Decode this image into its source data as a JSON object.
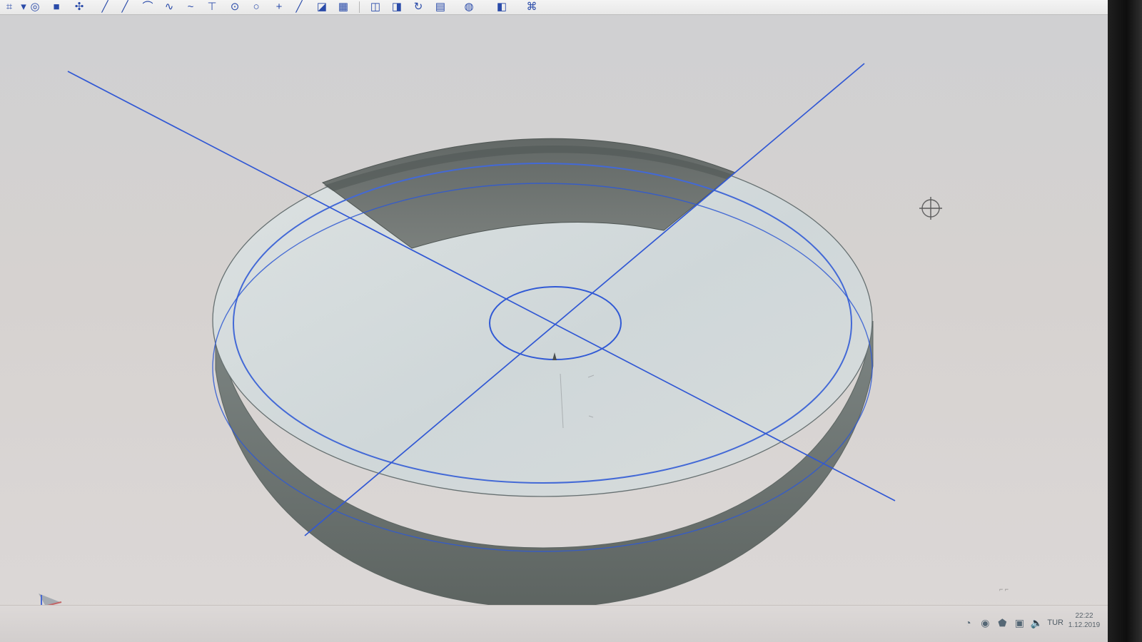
{
  "window": {
    "title": ""
  },
  "toolbar": {
    "icons": [
      "select-icon",
      "dropdown-icon",
      "sphere-icon",
      "box-icon",
      "dots-grid-icon",
      "line-icon",
      "line-icon",
      "curve-icon",
      "freeform-curve-icon",
      "wave-icon",
      "plane-icon",
      "circle-point-icon",
      "circle-icon",
      "plus-icon",
      "line-icon",
      "plane-icon",
      "grid-icon",
      "view-icon",
      "view-icon",
      "rotate-icon",
      "layers-icon",
      "palette-icon",
      "cube-icon",
      "lasso-icon"
    ]
  },
  "viewport": {
    "cursor": "crosshair",
    "axis_indicator": "axis-triad-icon"
  },
  "taskbar": {
    "lang": "TUR",
    "time": "22:22",
    "date": "1.12.2019"
  }
}
